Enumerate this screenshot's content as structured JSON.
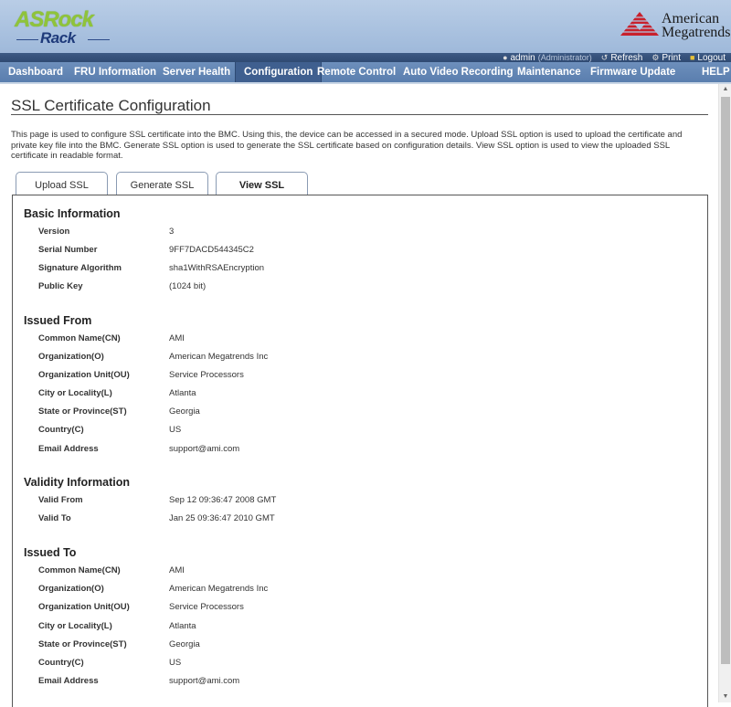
{
  "header": {
    "brand_top": "ASRock",
    "brand_bottom": "Rack",
    "vendor_line1": "American",
    "vendor_line2": "Megatrends"
  },
  "userbar": {
    "user": "admin",
    "role": "(Administrator)",
    "refresh": "Refresh",
    "print": "Print",
    "logout": "Logout"
  },
  "nav": {
    "items": [
      {
        "label": "Dashboard"
      },
      {
        "label": "FRU Information"
      },
      {
        "label": "Server Health"
      },
      {
        "label": "Configuration",
        "active": true
      },
      {
        "label": "Remote Control"
      },
      {
        "label": "Auto Video Recording"
      },
      {
        "label": "Maintenance"
      },
      {
        "label": "Firmware Update"
      },
      {
        "label": "HELP"
      }
    ]
  },
  "page": {
    "title": "SSL Certificate Configuration",
    "description": "This page is used to configure SSL certificate into the BMC. Using this, the device can be accessed in a secured mode. Upload SSL option is used to upload the certificate and private key file into the BMC. Generate SSL option is used to generate the SSL certificate based on configuration details. View SSL option is used to view the uploaded SSL certificate in readable format."
  },
  "tabs": [
    {
      "label": "Upload SSL"
    },
    {
      "label": "Generate SSL"
    },
    {
      "label": "View SSL",
      "active": true
    }
  ],
  "sections": {
    "basic": {
      "title": "Basic Information",
      "rows": [
        {
          "label": "Version",
          "value": "3"
        },
        {
          "label": "Serial Number",
          "value": "9FF7DACD544345C2"
        },
        {
          "label": "Signature Algorithm",
          "value": "sha1WithRSAEncryption"
        },
        {
          "label": "Public Key",
          "value": "(1024 bit)"
        }
      ]
    },
    "issued_from": {
      "title": "Issued From",
      "rows": [
        {
          "label": "Common Name(CN)",
          "value": "AMI"
        },
        {
          "label": "Organization(O)",
          "value": "American Megatrends Inc"
        },
        {
          "label": "Organization Unit(OU)",
          "value": "Service Processors"
        },
        {
          "label": "City or Locality(L)",
          "value": "Atlanta"
        },
        {
          "label": "State or Province(ST)",
          "value": "Georgia"
        },
        {
          "label": "Country(C)",
          "value": "US"
        },
        {
          "label": "Email Address",
          "value": "support@ami.com"
        }
      ]
    },
    "validity": {
      "title": "Validity Information",
      "rows": [
        {
          "label": "Valid From",
          "value": "Sep 12 09:36:47 2008 GMT"
        },
        {
          "label": "Valid To",
          "value": "Jan 25 09:36:47 2010 GMT"
        }
      ]
    },
    "issued_to": {
      "title": "Issued To",
      "rows": [
        {
          "label": "Common Name(CN)",
          "value": "AMI"
        },
        {
          "label": "Organization(O)",
          "value": "American Megatrends Inc"
        },
        {
          "label": "Organization Unit(OU)",
          "value": "Service Processors"
        },
        {
          "label": "City or Locality(L)",
          "value": "Atlanta"
        },
        {
          "label": "State or Province(ST)",
          "value": "Georgia"
        },
        {
          "label": "Country(C)",
          "value": "US"
        },
        {
          "label": "Email Address",
          "value": "support@ami.com"
        }
      ]
    }
  },
  "colors": {
    "brand_green": "#8fc43a",
    "brand_navy": "#1e3a7a",
    "nav_bg": "#5a7eae",
    "nav_active": "#3f5f8f",
    "ami_red": "#c8202c"
  }
}
